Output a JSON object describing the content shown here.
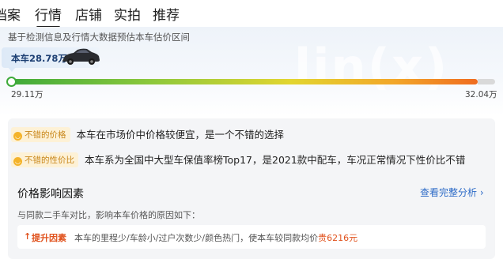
{
  "tabs": [
    {
      "label": "档案",
      "active": false
    },
    {
      "label": "行情",
      "active": true
    },
    {
      "label": "店铺",
      "active": false
    },
    {
      "label": "实拍",
      "active": false
    },
    {
      "label": "推荐",
      "active": false
    }
  ],
  "estimate": {
    "description": "基于检测信息及行情大数据预估本车估价区间",
    "price_tag": "本车28.78万",
    "watermark": "lin(x)",
    "range_min": "29.11万",
    "range_max": "32.04万"
  },
  "highlights": [
    {
      "badge": "不错的价格",
      "text": "本车在市场价中价格较便宜，是一个不错的选择"
    },
    {
      "badge": "不错的性价比",
      "text": "本车系为全国中大型车保值率榜Top17，是2021款中配车，车况正常情况下性价比不错"
    }
  ],
  "factors": {
    "title": "价格影响因素",
    "link": "查看完整分析",
    "compare_text": "与同款二手车对比，影响本车价格的原因如下：",
    "items": [
      {
        "label": "提升因素",
        "text": "本车的里程少/车龄小/过户次数少/颜色热门，使本车较同款均价",
        "amount": "贵6216元"
      }
    ]
  },
  "colors": {
    "accent": "#2d6bc7",
    "warn": "#e0521d",
    "badge_bg": "#fdf1d6",
    "badge_fg": "#c9871a"
  }
}
